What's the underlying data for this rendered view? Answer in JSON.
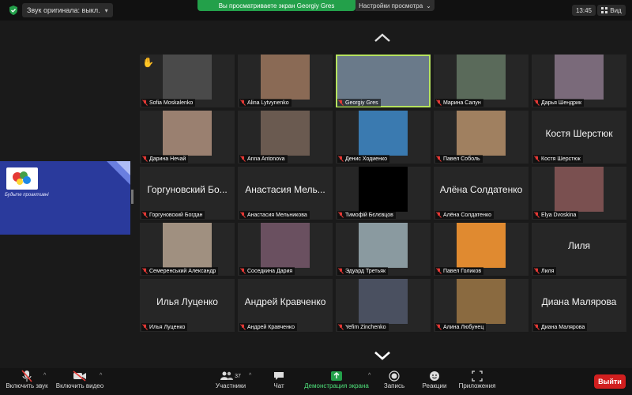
{
  "topbar": {
    "original_sound": "Звук оригинала: выкл.",
    "sharing_banner": "Вы просматриваете экран Georgiy Gres",
    "view_settings": "Настройки просмотра",
    "clock": "13:45",
    "view": "Вид"
  },
  "slide": {
    "text": "Будьте проактивні"
  },
  "participants": [
    {
      "name": "Sofia Moskalenko",
      "hand": true
    },
    {
      "name": "Alina Lytvynenko"
    },
    {
      "name": "Georgiy Gres",
      "active": true
    },
    {
      "name": "Марина Салун"
    },
    {
      "name": "Дарья Шендрик"
    },
    {
      "name": "Дарина Нечай"
    },
    {
      "name": "Anna Antonova"
    },
    {
      "name": "Денис Ходиенко"
    },
    {
      "name": "Павел Соболь"
    },
    {
      "name": "Костя Шерстюк",
      "big": "Костя Шерстюк"
    },
    {
      "name": "Горгуновский Богдан",
      "big": "Горгуновский Бо..."
    },
    {
      "name": "Анастасия Мельникова",
      "big": "Анастасия Мель..."
    },
    {
      "name": "Тимофій Бєлєвцов"
    },
    {
      "name": "Алёна Солдатенко",
      "big": "Алёна Солдатенко"
    },
    {
      "name": "Elya Dvoskina"
    },
    {
      "name": "Семеренський Александр"
    },
    {
      "name": "Соседкина Дария"
    },
    {
      "name": "Эдуард Третьяк"
    },
    {
      "name": "Павел Голиков"
    },
    {
      "name": "Лиля",
      "big": "Лиля"
    },
    {
      "name": "Илья Луценко",
      "big": "Илья Луценко"
    },
    {
      "name": "Андрей Кравченко",
      "big": "Андрей Кравченко"
    },
    {
      "name": "Yefim Zinchenko"
    },
    {
      "name": "Алина Любунец"
    },
    {
      "name": "Диана Малярова",
      "big": "Диана Малярова"
    }
  ],
  "toolbar": {
    "unmute": "Включить звук",
    "start_video": "Включить видео",
    "participants": "Участники",
    "participants_count": "37",
    "chat": "Чат",
    "share_screen": "Демонстрация экрана",
    "record": "Запись",
    "reactions": "Реакции",
    "apps": "Приложения",
    "leave": "Выйти"
  },
  "colors": {
    "share_green": "#23a04a",
    "leave_red": "#d11f1f",
    "active_speaker": "#b6e35f",
    "slide_blue": "#2a3a9c"
  }
}
